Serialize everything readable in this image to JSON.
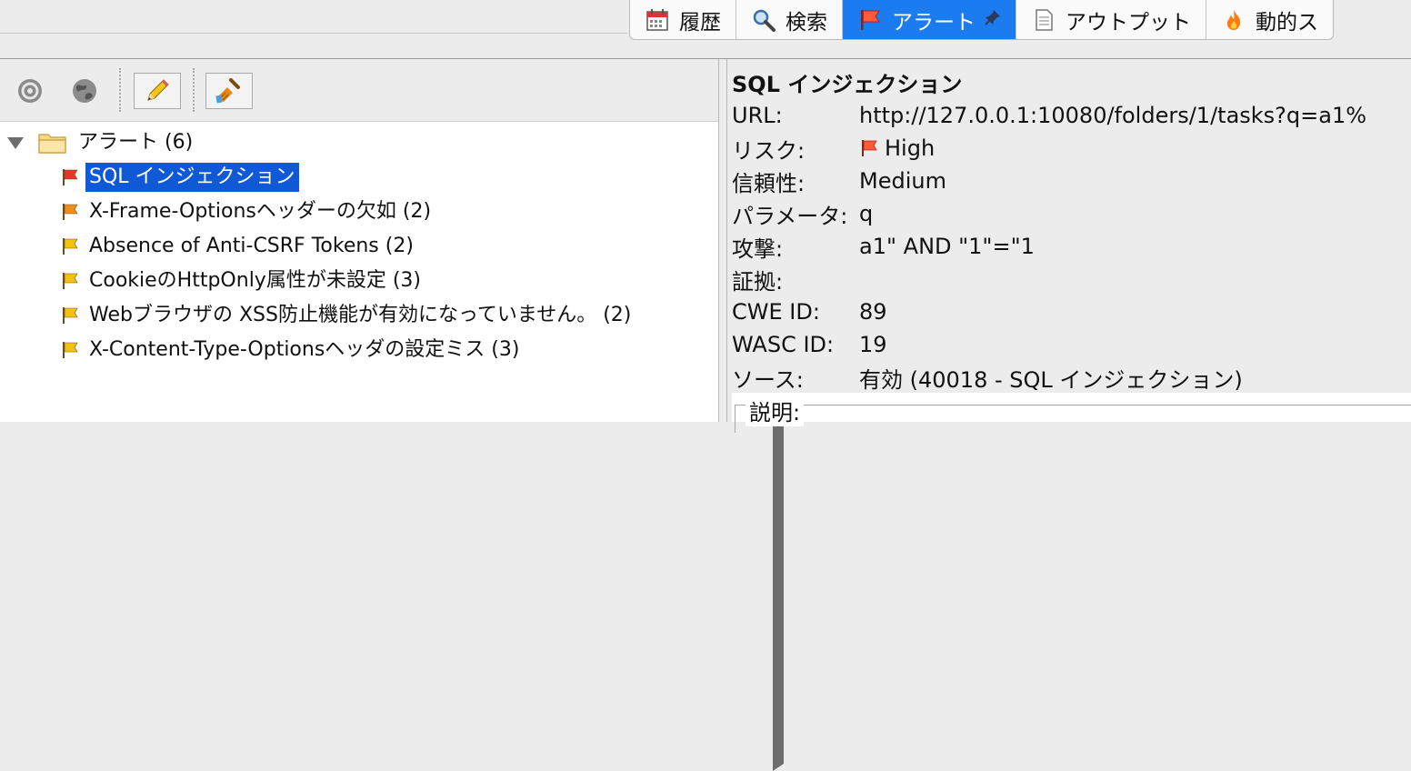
{
  "tabs": [
    {
      "label": "履歴",
      "icon": "calendar-icon",
      "active": false
    },
    {
      "label": "検索",
      "icon": "magnifier-icon",
      "active": false
    },
    {
      "label": "アラート",
      "icon": "red-flag-icon",
      "active": true
    },
    {
      "label": "アウトプット",
      "icon": "document-icon",
      "active": false
    },
    {
      "label": "動的ス",
      "icon": "fire-icon",
      "active": false
    }
  ],
  "toolbar": {
    "icons": [
      "target-icon",
      "globe-icon",
      "pencil-icon",
      "broom-icon"
    ]
  },
  "tree": {
    "root": {
      "label": "アラート (6)",
      "icon": "folder-icon"
    },
    "items": [
      {
        "label": "SQL インジェクション",
        "risk": "high",
        "selected": true
      },
      {
        "label": "X-Frame-Optionsヘッダーの欠如 (2)",
        "risk": "medium",
        "selected": false
      },
      {
        "label": "Absence of Anti-CSRF Tokens (2)",
        "risk": "low",
        "selected": false
      },
      {
        "label": "CookieのHttpOnly属性が未設定 (3)",
        "risk": "low",
        "selected": false
      },
      {
        "label": "Webブラウザの XSS防止機能が有効になっていません。 (2)",
        "risk": "low",
        "selected": false
      },
      {
        "label": "X-Content-Type-Optionsヘッダの設定ミス (3)",
        "risk": "low",
        "selected": false
      }
    ]
  },
  "colors": {
    "high": "#e8352a",
    "medium": "#f08c1a",
    "low": "#f2c20f",
    "accent": "#1a7cf0",
    "selection": "#0f58d6"
  },
  "detail": {
    "title": "SQL インジェクション",
    "rows": [
      {
        "key": "URL:",
        "value": "http://127.0.0.1:10080/folders/1/tasks?q=a1%"
      },
      {
        "key": "リスク:",
        "value": "High",
        "flag": true
      },
      {
        "key": "信頼性:",
        "value": "Medium"
      },
      {
        "key": "パラメータ:",
        "value": "q"
      },
      {
        "key": "攻撃:",
        "value": "a1\" AND \"1\"=\"1"
      },
      {
        "key": "証拠:",
        "value": ""
      },
      {
        "key": "CWE ID:",
        "value": "89"
      },
      {
        "key": "WASC ID:",
        "value": "19"
      },
      {
        "key": "ソース:",
        "value": "有効 (40018 - SQL インジェクション)"
      }
    ],
    "description_label": "説明:"
  }
}
